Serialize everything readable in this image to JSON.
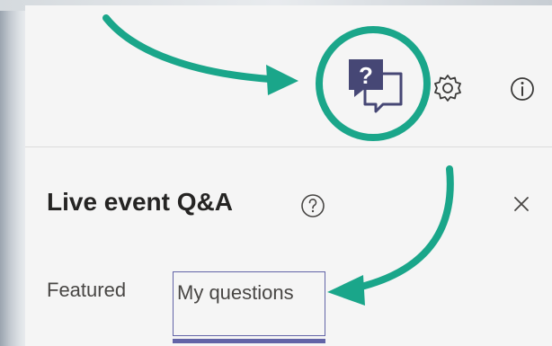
{
  "header": {
    "qa_icon": "qa-chat-icon",
    "settings_icon": "gear-icon",
    "info_icon": "info-icon"
  },
  "panel": {
    "title": "Live event Q&A",
    "help_icon": "help-icon",
    "close_icon": "close-icon"
  },
  "tabs": [
    {
      "label": "Featured",
      "selected": false
    },
    {
      "label": "My questions",
      "selected": true
    }
  ],
  "colors": {
    "annotation_green": "#1aa68a",
    "accent_purple": "#6264a7",
    "qa_icon_dark": "#464775"
  }
}
